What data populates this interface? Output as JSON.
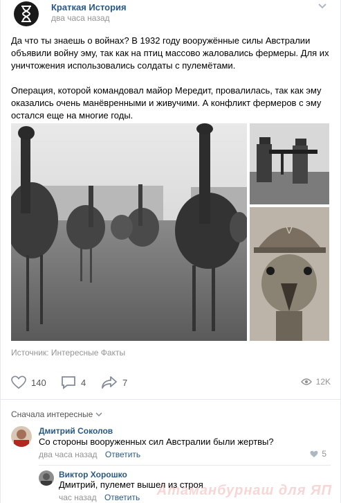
{
  "post": {
    "group_name": "Краткая История",
    "time": "два часа назад",
    "paragraph_1": "Да что ты знаешь о войнах? В 1932 году вооружённые силы Австралии объявили войну эму, так как на птиц массово жаловались фермеры. Для их уничтожения использовались солдаты с пулемётами.",
    "paragraph_2": "Операция, которой командовал майор Мередит, провалилась, так как эму оказались очень манёвренными и живучими. А конфликт фермеров с эму остался еще на многие годы.",
    "source": "Источник: Интересные Факты",
    "likes": "140",
    "comments": "4",
    "shares": "7",
    "views": "12K"
  },
  "comments_section": {
    "sort_label": "Сначала интересные"
  },
  "comments": [
    {
      "author": "Дмитрий Соколов",
      "text": "Со стороны вооруженных сил Австралии были жертвы?",
      "time": "два часа назад",
      "reply": "Ответить",
      "likes": "5"
    },
    {
      "author": "Виктор Хорошко",
      "text": "Дмитрий, пулемет вышел из строя",
      "time": "час назад",
      "reply": "Ответить"
    }
  ],
  "watermark": "Атаманбурнаш для ЯП",
  "colors": {
    "link": "#2a5885",
    "muted": "#939393",
    "divider": "#e7e8ec"
  },
  "icons": [
    "hourglass-icon",
    "chevron-down-icon",
    "heart-icon",
    "comment-icon",
    "share-icon",
    "eye-icon"
  ]
}
